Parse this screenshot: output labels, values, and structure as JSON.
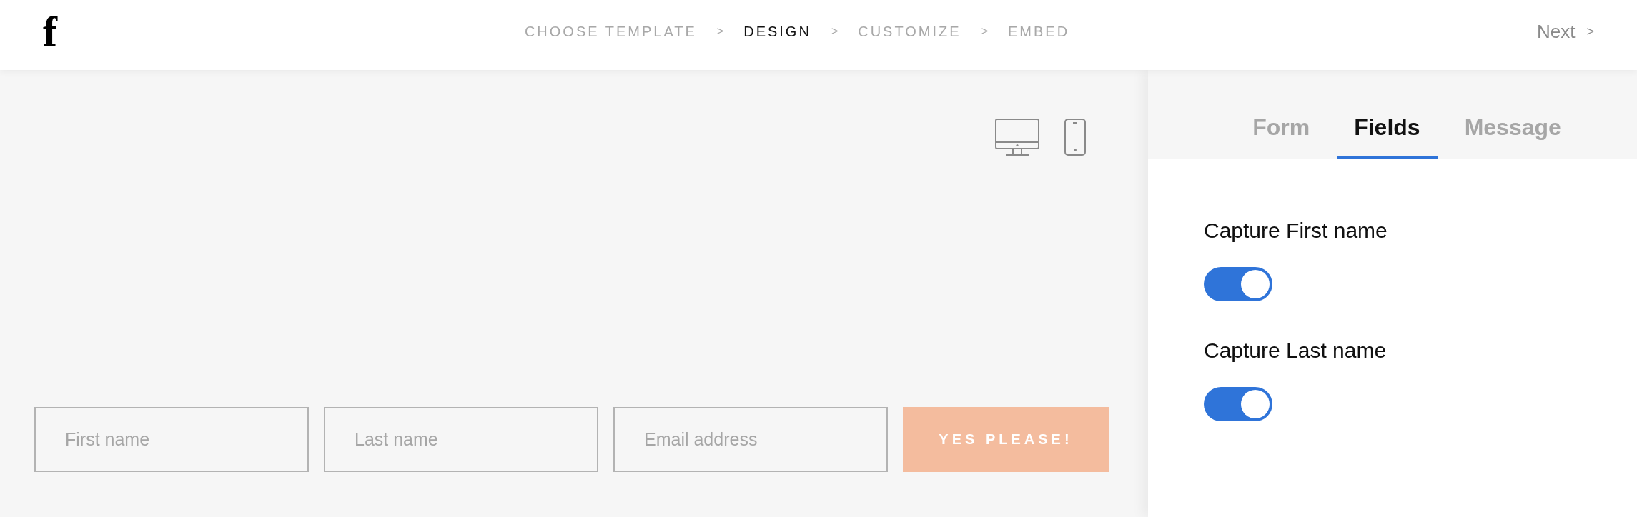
{
  "logo": "f",
  "steps": [
    {
      "label": "CHOOSE TEMPLATE",
      "selected": false
    },
    {
      "label": "DESIGN",
      "selected": true
    },
    {
      "label": "CUSTOMIZE",
      "selected": false
    },
    {
      "label": "EMBED",
      "selected": false
    }
  ],
  "step_separators": [
    ">",
    ">",
    ">"
  ],
  "next_button": {
    "label": "Next",
    "arrow": ">"
  },
  "preview": {
    "devices": [
      {
        "kind": "desktop"
      },
      {
        "kind": "mobile"
      }
    ],
    "signup_form": {
      "fields": [
        {
          "placeholder": "First name"
        },
        {
          "placeholder": "Last name"
        },
        {
          "placeholder": "Email address"
        }
      ],
      "submit_button": "YES PLEASE!"
    }
  },
  "panel": {
    "tabs": [
      {
        "label": "Form",
        "selected": false
      },
      {
        "label": "Fields",
        "selected": true
      },
      {
        "label": "Message",
        "selected": false
      }
    ],
    "settings": [
      {
        "label": "Capture First name",
        "on": true
      },
      {
        "label": "Capture Last name",
        "on": true
      }
    ]
  }
}
